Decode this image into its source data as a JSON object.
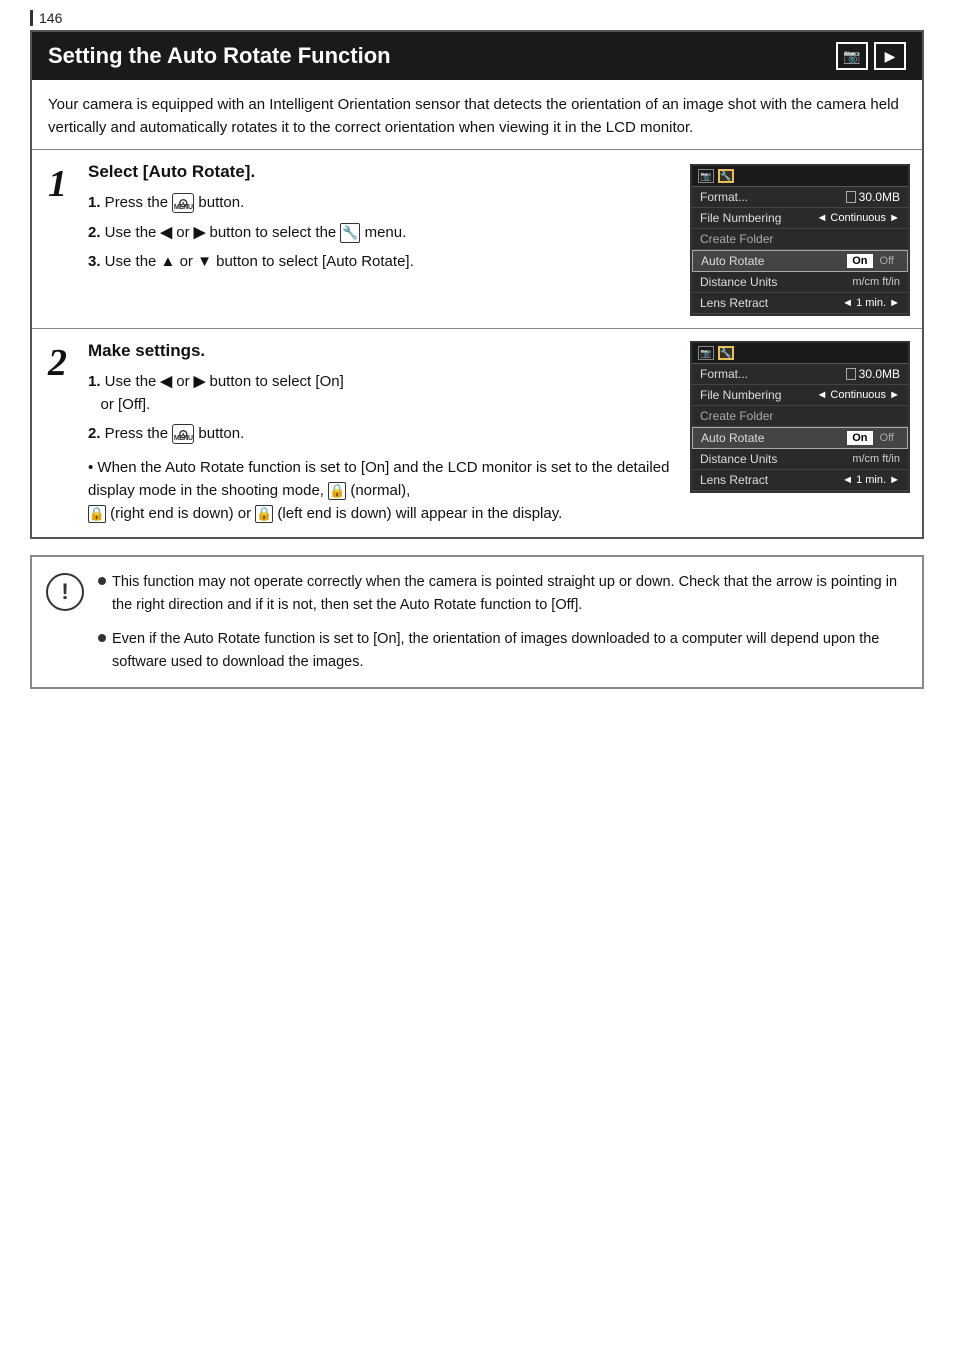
{
  "page": {
    "number": "146",
    "title": "Setting the Auto Rotate Function",
    "icons": [
      "camera-icon",
      "play-icon"
    ],
    "intro": "Your camera is equipped with an Intelligent Orientation sensor that detects the orientation of an image shot with the camera held vertically and automatically rotates it to the correct orientation when viewing it in the LCD monitor."
  },
  "step1": {
    "number": "1",
    "title": "Select [Auto Rotate].",
    "items": [
      {
        "num": "1.",
        "text": "Press the",
        "type": "menu-button",
        "after": "button."
      },
      {
        "num": "2.",
        "text": "Use the",
        "arrow_left": "←",
        "or": "or",
        "arrow_right": "→",
        "after_text": "button to select the",
        "icon": "wrench",
        "end": "menu."
      },
      {
        "num": "3.",
        "text": "Use the",
        "arrow_up": "▲",
        "or": "or",
        "arrow_down": "▼",
        "after_text": "button to select [Auto Rotate]."
      }
    ],
    "screen": {
      "tabs": [
        {
          "label": "📷",
          "active": false
        },
        {
          "label": "🔧",
          "active": true
        }
      ],
      "rows": [
        {
          "label": "Format...",
          "icon": "file",
          "value": "30.0MB"
        },
        {
          "label": "File Numbering",
          "arrow": "◄",
          "value": "Continuous",
          "arrow_r": "►"
        },
        {
          "label": "Create Folder",
          "strikethrough": false
        },
        {
          "label": "Auto Rotate",
          "highlight": true,
          "on_off": true
        },
        {
          "label": "Distance Units",
          "value": "m/cm ft/in",
          "muted": true
        },
        {
          "label": "Lens Retract",
          "arrow": "◄",
          "value": "1 min.",
          "arrow_r": "►"
        }
      ]
    }
  },
  "step2": {
    "number": "2",
    "title": "Make settings.",
    "items": [
      {
        "num": "1.",
        "text": "Use the",
        "arrow_left": "←",
        "or": "or",
        "arrow_right": "→",
        "after_text": "button to select [On] or [Off]."
      },
      {
        "num": "2.",
        "text": "Press the",
        "type": "menu-button",
        "after": "button."
      }
    ],
    "extra": "• When the Auto Rotate function is set to [On] and the LCD monitor is set to the detailed display mode in the shooting mode,",
    "extra2": "(normal),",
    "extra3": "(right end is down) or",
    "extra4": "(left end is down) will appear in the display.",
    "screen": {
      "tabs": [
        {
          "label": "📷",
          "active": false
        },
        {
          "label": "🔧",
          "active": true
        }
      ],
      "rows": [
        {
          "label": "Format...",
          "icon": "file",
          "value": "30.0MB"
        },
        {
          "label": "File Numbering",
          "arrow": "◄",
          "value": "Continuous",
          "arrow_r": "►"
        },
        {
          "label": "Create Folder",
          "muted": true
        },
        {
          "label": "Auto Rotate",
          "highlight": true,
          "on_off": true
        },
        {
          "label": "Distance Units",
          "value": "m/cm ft/in",
          "muted": true
        },
        {
          "label": "Lens Retract",
          "arrow": "◄",
          "value": "1 min.",
          "arrow_r": "►"
        }
      ]
    }
  },
  "notes": [
    "This function may not operate correctly when the camera is pointed straight up or down. Check that the arrow is pointing in the right direction and if it is not, then set the Auto Rotate function to [Off].",
    "Even if the Auto Rotate function is set to [On], the orientation of images downloaded to a computer will depend upon the software used to download the images."
  ],
  "labels": {
    "on": "On",
    "off": "Off",
    "format": "Format...",
    "file_numbering": "File Numbering",
    "continuous": "Continuous",
    "create_folder": "Create Folder",
    "auto_rotate": "Auto Rotate",
    "distance_units": "Distance Units",
    "distance_val": "m/cm ft/in",
    "lens_retract": "Lens Retract",
    "lens_val": "1 min.",
    "file_size": "30.0MB",
    "menu": "MENU",
    "or": "or"
  }
}
